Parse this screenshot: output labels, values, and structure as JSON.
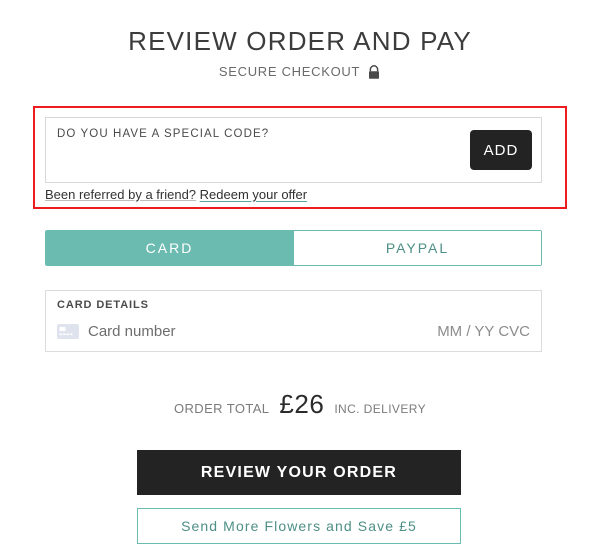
{
  "header": {
    "title": "REVIEW ORDER AND PAY",
    "subtitle": "SECURE CHECKOUT",
    "lock_icon": "lock-icon"
  },
  "promo": {
    "label": "DO YOU HAVE A SPECIAL CODE?",
    "input_value": "",
    "input_placeholder": "",
    "add_label": "ADD",
    "referral_text": "Been referred by a friend?",
    "referral_link": "Redeem your offer",
    "highlight_color": "#ee1c1c"
  },
  "payment_tabs": {
    "items": [
      {
        "label": "CARD",
        "active": true
      },
      {
        "label": "PAYPAL",
        "active": false
      }
    ],
    "accent_color": "#6cbbb1"
  },
  "card_details": {
    "label": "CARD DETAILS",
    "card_icon": "credit-card-icon",
    "number_placeholder": "Card number",
    "number_value": "",
    "expiry_cvc": "MM / YY  CVC"
  },
  "order_total": {
    "label": "ORDER TOTAL",
    "amount": "£26",
    "note": "INC. DELIVERY"
  },
  "actions": {
    "review_label": "REVIEW YOUR ORDER",
    "upsell_label": "Send More Flowers and Save £5",
    "review_bg": "#232323"
  }
}
